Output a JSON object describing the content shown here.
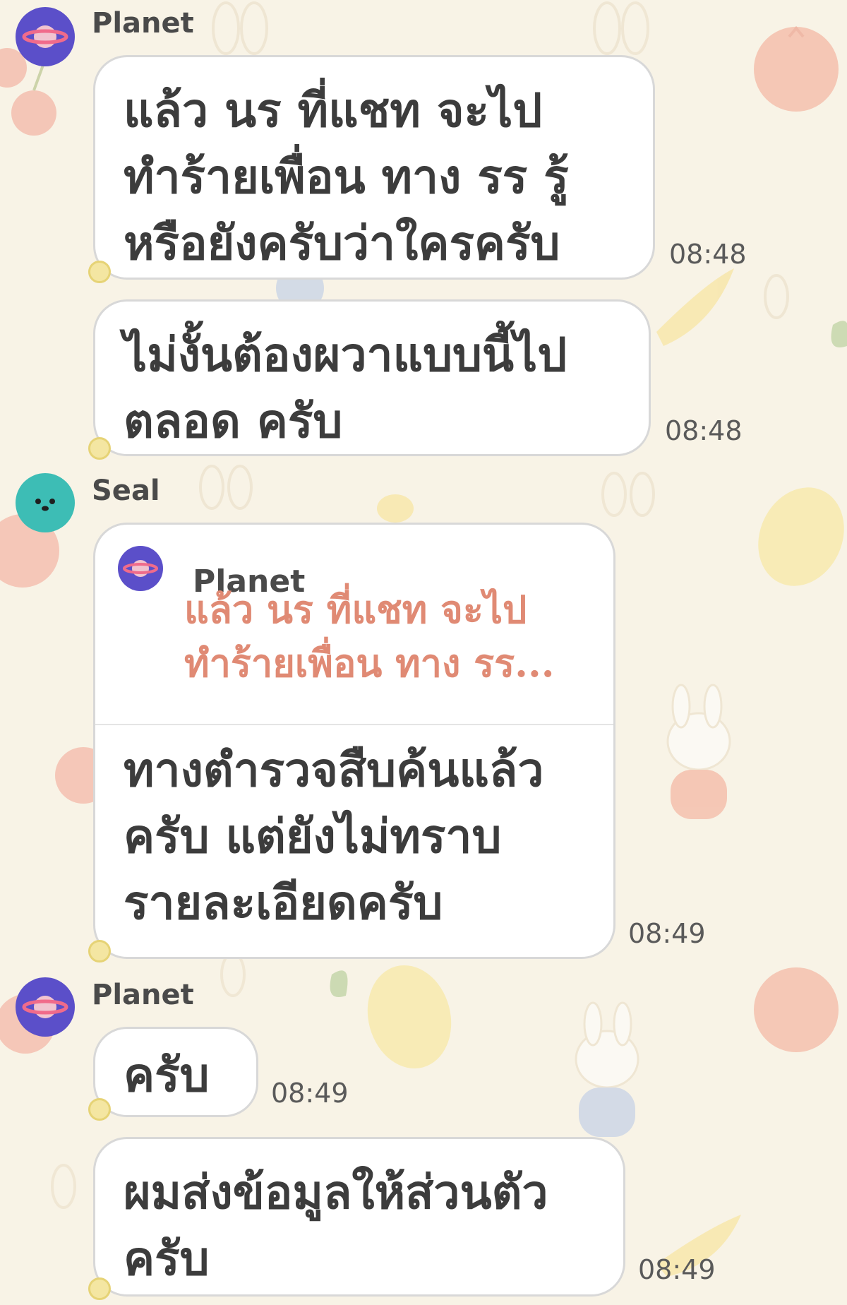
{
  "chat": {
    "messages": [
      {
        "sender": "Planet",
        "text": [
          "แล้ว นร ที่แชท จะไป",
          "ทำร้ายเพื่อน ทาง รร รู้",
          "หรือยังครับว่าใครครับ"
        ],
        "time": "08:48"
      },
      {
        "text": [
          "ไม่งั้นต้องผวาแบบนี้ไป",
          "ตลอด ครับ"
        ],
        "time": "08:48"
      },
      {
        "sender": "Seal",
        "reply": {
          "name": "Planet",
          "quote": [
            "แล้ว นร ที่แชท จะไป",
            "ทำร้ายเพื่อน ทาง รร..."
          ]
        },
        "text": [
          "ทางตำรวจสืบค้นแล้ว",
          "ครับ แต่ยังไม่ทราบ",
          "รายละเอียดครับ"
        ],
        "time": "08:49"
      },
      {
        "sender": "Planet",
        "text": [
          "ครับ"
        ],
        "time": "08:49"
      },
      {
        "text": [
          "ผมส่งข้อมูลให้ส่วนตัว",
          "ครับ"
        ],
        "time": "08:49"
      }
    ]
  },
  "colors": {
    "background": "#f8f3e6",
    "planet_avatar": "#5b4fc9",
    "seal_avatar": "#3dbdb5",
    "quote_text": "#e08a74",
    "bubble_tail": "#f4e6a2"
  }
}
